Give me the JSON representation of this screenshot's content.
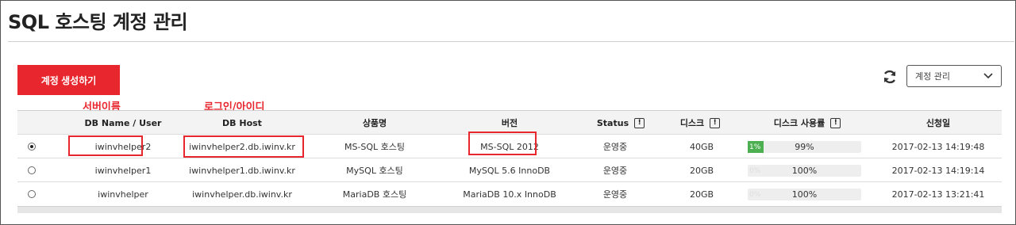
{
  "page": {
    "title": "SQL 호스팅 계정 관리"
  },
  "toolbar": {
    "create_label": "계정 생성하기",
    "refresh_icon": "refresh-icon",
    "select_value": "계정 관리"
  },
  "annotations": {
    "server_name": "서버이름",
    "login_id": "로그인/아이디"
  },
  "table": {
    "headers": {
      "db_name": "DB Name / User",
      "db_host": "DB Host",
      "product": "상품명",
      "version": "버전",
      "status": "Status",
      "disk": "디스크",
      "disk_usage": "디스크 사용률",
      "created": "신청일"
    },
    "info_mark": "!",
    "rows": [
      {
        "selected": true,
        "name": "iwinvhelper2",
        "host": "iwinvhelper2.db.iwinv.kr",
        "product": "MS-SQL 호스팅",
        "version": "MS-SQL 2012",
        "status": "운영중",
        "disk": "40GB",
        "usage_fraction": 0.01,
        "usage_pct": "1%",
        "remaining": "99%",
        "date": "2017-02-13 14:19:48"
      },
      {
        "selected": false,
        "name": "iwinvhelper1",
        "host": "iwinvhelper1.db.iwinv.kr",
        "product": "MySQL 호스팅",
        "version": "MySQL 5.6 InnoDB",
        "status": "운영중",
        "disk": "20GB",
        "usage_fraction": 0.0,
        "usage_pct": "0%",
        "remaining": "100%",
        "date": "2017-02-13 14:19:14"
      },
      {
        "selected": false,
        "name": "iwinvhelper",
        "host": "iwinvhelper.db.iwinv.kr",
        "product": "MariaDB 호스팅",
        "version": "MariaDB 10.x InnoDB",
        "status": "운영중",
        "disk": "20GB",
        "usage_fraction": 0.0,
        "usage_pct": "0%",
        "remaining": "100%",
        "date": "2017-02-13 13:21:41"
      }
    ]
  },
  "colors": {
    "accent": "#e8262d",
    "usage_bar": "#4caf50"
  }
}
